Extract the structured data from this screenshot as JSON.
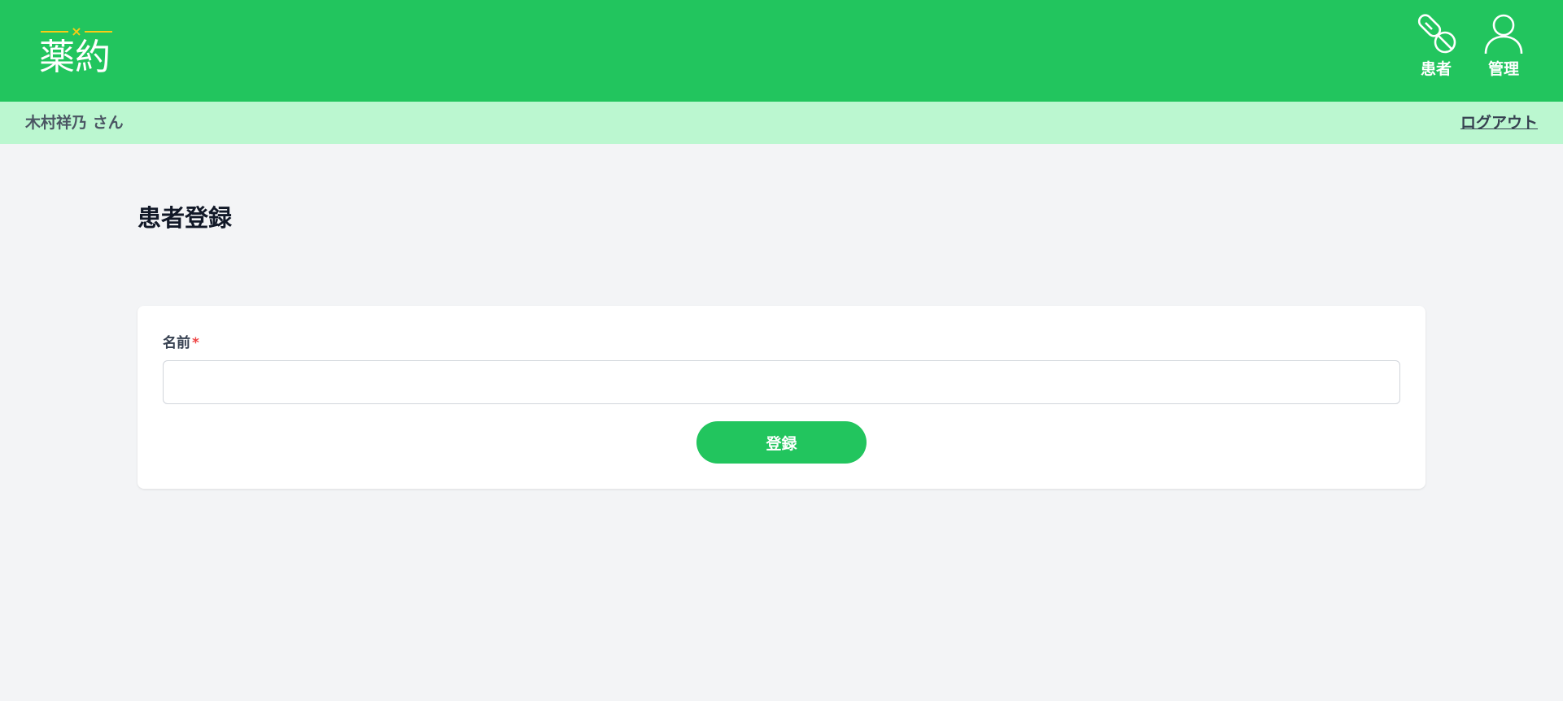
{
  "app": {
    "logo_text": "薬約",
    "logo_mark": "×"
  },
  "nav": {
    "patient_label": "患者",
    "patient_icon": "pill-icon",
    "admin_label": "管理",
    "admin_icon": "user-icon"
  },
  "subbar": {
    "user_name": "木村祥乃 さん",
    "logout_label": "ログアウト"
  },
  "page": {
    "title": "患者登録"
  },
  "form": {
    "name_label": "名前",
    "required_mark": "*",
    "name_value": "",
    "name_placeholder": "",
    "submit_label": "登録"
  },
  "colors": {
    "primary": "#22c55e",
    "subbar": "#bbf7d0",
    "logo_accent": "#facc15",
    "background": "#f3f4f6",
    "required": "#ef4444"
  }
}
